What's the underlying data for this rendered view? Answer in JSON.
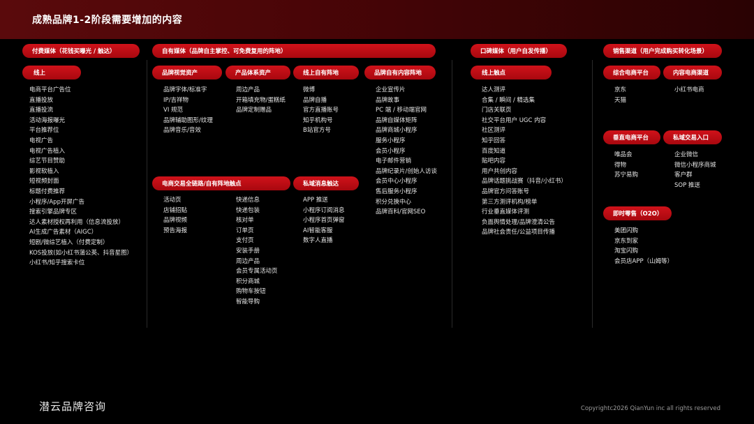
{
  "title": "成熟品牌1-2阶段需要增加的内容",
  "pills": {
    "paid": "付费媒体（花钱买曝光 / 触达）",
    "owned": "自有媒体（品牌自主掌控、可免费复用的阵地）",
    "earned": "口碑媒体（用户自发传播）",
    "sales": "销售渠道（用户完成购买转化场景）",
    "online_paid": "线上",
    "brand_visual": "品牌视觉资产",
    "product_system": "产品体系资产",
    "online_owned": "线上自有阵地",
    "brand_content": "品牌自有内容阵地",
    "ecommerce_touch": "电商交易全链路/自有阵地触点",
    "private_msg": "私域消息触达",
    "online_touch": "线上触点",
    "integrated_ecom": "综合电商平台",
    "content_ecom": "内容电商渠道",
    "vertical_ecom": "垂直电商平台",
    "private_entry": "私域交易入口",
    "instant_retail": "即时零售（O2O）"
  },
  "lists": {
    "online_paid": [
      "电商平台广告位",
      "直播投放",
      "直播投流",
      "活动海报曝光",
      "平台推荐位",
      "电视广告",
      "电视广告植入",
      "综艺节目赞助",
      "影视软植入",
      "短视频封面",
      "标题付费推荐",
      "小程序/App开屏广告",
      "搜索引擎品牌专区",
      "达人素材授权再利用（信息流投放）",
      "AI生成广告素材（AIGC）",
      "短剧/微综艺植入（付费定制）",
      "KOS投放(如小红书蒲公英、抖音星图）",
      "小红书/知乎搜索卡位"
    ],
    "brand_visual": [
      "品牌字体/标准字",
      "IP/吉祥物",
      "VI 规范",
      "品牌辅助图形/纹理",
      "品牌音乐/音效"
    ],
    "product_system": [
      "周边产品",
      "开箱填充物/蛋糕纸",
      "品牌定制赠品"
    ],
    "online_owned": [
      "微博",
      "品牌自播",
      "官方直播账号",
      "知乎机构号",
      "B站官方号"
    ],
    "brand_content": [
      "企业宣传片",
      "品牌故事",
      "PC 端 / 移动端官网",
      "品牌自媒体矩阵",
      "品牌商城小程序",
      "服务小程序",
      "会员小程序",
      "电子邮件营销",
      "品牌纪录片/创始人访谈",
      "会员中心小程序",
      "售后服务小程序",
      "积分兑换中心",
      "品牌百科/官网SEO"
    ],
    "ecommerce_touch_a": [
      "活动页",
      "店铺招贴",
      "品牌视频",
      "预告海报"
    ],
    "ecommerce_touch_b": [
      "快递信息",
      "快递包装",
      "核对单",
      "订单页",
      "支付页",
      "安装手册",
      "周边产品",
      "会员专属活动页",
      "积分商城",
      "购物车按钮",
      "智能导购"
    ],
    "private_msg": [
      "APP 推送",
      "小程序订阅消息",
      "小程序首页弹窗",
      "AI智能客服",
      "数字人直播"
    ],
    "online_touch": [
      "达人测评",
      "合集 / 瞬间 / 精选集",
      "门店关联页",
      "社交平台用户 UGC 内容",
      "社区测评",
      "知乎回答",
      "百度知道",
      "贴吧内容",
      "用户共创内容",
      "品牌话题挑战赛（抖音/小红书）",
      "品牌官方问答账号",
      "第三方测评机构/榜单",
      "行业垂直媒体评测",
      "负面舆情处理/品牌澄清公告",
      "品牌社会责任/公益项目传播"
    ],
    "integrated_ecom": [
      "京东",
      "天猫"
    ],
    "content_ecom": [
      "小红书电商"
    ],
    "vertical_ecom": [
      "唯品会",
      "得物",
      "苏宁易购"
    ],
    "private_entry": [
      "企业微信",
      "微信小程序商城",
      "客户群",
      "SOP 推送"
    ],
    "instant_retail": [
      "美团闪购",
      "京东到家",
      "淘宝闪购",
      "会员店APP（山姆等）"
    ]
  },
  "footer": {
    "logo": "潜云品牌咨询",
    "copyright": "Copyrightc2026 QianYun inc all rights reserved"
  }
}
